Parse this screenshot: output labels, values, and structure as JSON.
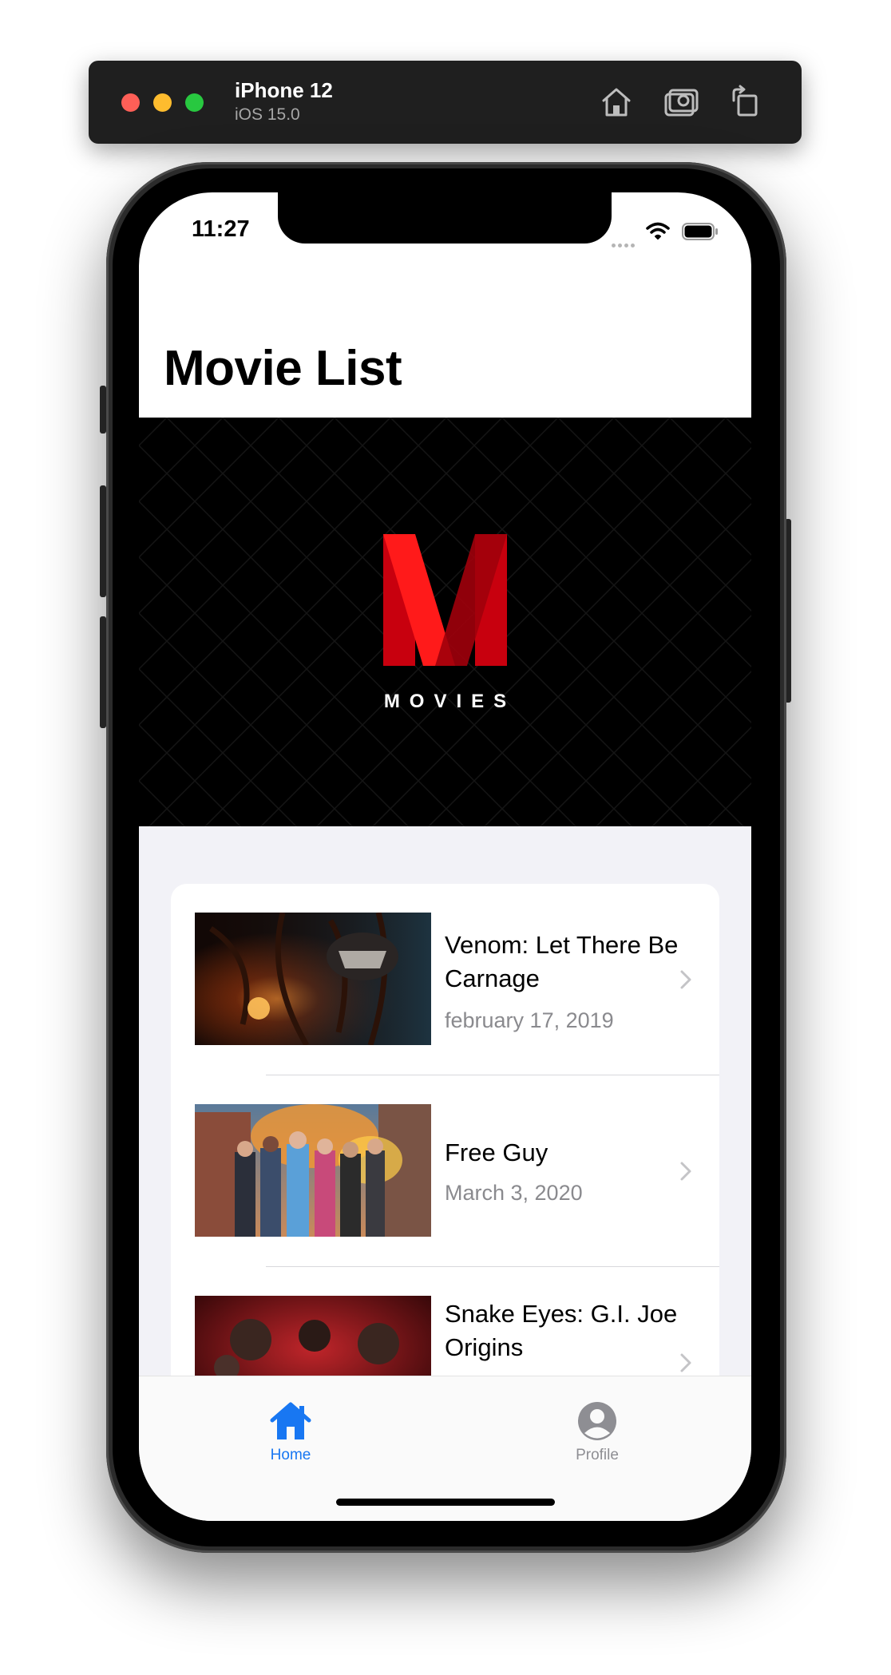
{
  "simulator": {
    "device_name": "iPhone 12",
    "os_version": "iOS 15.0",
    "toolbar_buttons": [
      "home-icon",
      "screenshot-icon",
      "rotate-icon"
    ]
  },
  "status_bar": {
    "time": "11:27"
  },
  "nav": {
    "title": "Movie List"
  },
  "banner": {
    "logo_letter": "M",
    "logo_text": "MOVIES",
    "accent_color": "#e50914"
  },
  "movies": [
    {
      "title": "Venom: Let There Be Carnage",
      "date": "february 17, 2019"
    },
    {
      "title": "Free Guy",
      "date": "March 3, 2020"
    },
    {
      "title": "Snake Eyes: G.I. Joe Origins",
      "date": ""
    }
  ],
  "tabbar": {
    "items": [
      {
        "label": "Home",
        "icon": "house-icon",
        "selected": true,
        "color": "#1877f2"
      },
      {
        "label": "Profile",
        "icon": "person-circle-icon",
        "selected": false,
        "color": "#8e8e93"
      }
    ]
  }
}
